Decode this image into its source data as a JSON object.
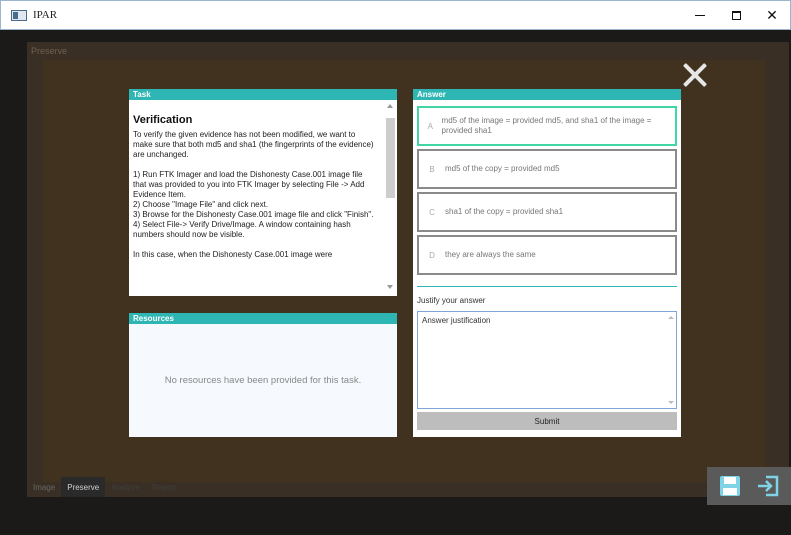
{
  "window": {
    "title": "IPAR"
  },
  "stage": {
    "label": "Preserve"
  },
  "task": {
    "header": "Task",
    "title": "Verification",
    "paragraphs": [
      "To verify the given evidence has not been modified, we want to make sure that both md5 and sha1 (the fingerprints of the evidence) are unchanged.",
      "1) Run FTK Imager and load the Dishonesty Case.001 image file that was provided to you into FTK Imager by selecting File -> Add Evidence Item.\n2) Choose \"Image File\" and click next.\n3) Browse for the Dishonesty Case.001 image file and click \"Finish\".\n4) Select File-> Verify Drive/Image. A window containing hash numbers should now be visible.",
      "In this case, when the Dishonesty Case.001 image were"
    ]
  },
  "resources": {
    "header": "Resources",
    "empty_message": "No resources have been provided for this task."
  },
  "answer": {
    "header": "Answer",
    "options": [
      {
        "letter": "A",
        "text": "md5 of the image = provided md5, and sha1 of the image = provided sha1"
      },
      {
        "letter": "B",
        "text": "md5 of the copy = provided md5"
      },
      {
        "letter": "C",
        "text": "sha1 of the copy = provided sha1"
      },
      {
        "letter": "D",
        "text": "they are always the same"
      }
    ],
    "selected": "A",
    "justify_label": "Justify your answer",
    "justify_value": "Answer justification",
    "submit_label": "Submit"
  },
  "tabs": [
    {
      "label": "Image",
      "state": "normal"
    },
    {
      "label": "Preserve",
      "state": "active"
    },
    {
      "label": "Analyze",
      "state": "dim"
    },
    {
      "label": "Report",
      "state": "dim"
    }
  ],
  "colors": {
    "accent": "#2db6b3",
    "selected_border": "#41d6a6",
    "stage_bg": "#40321f"
  }
}
